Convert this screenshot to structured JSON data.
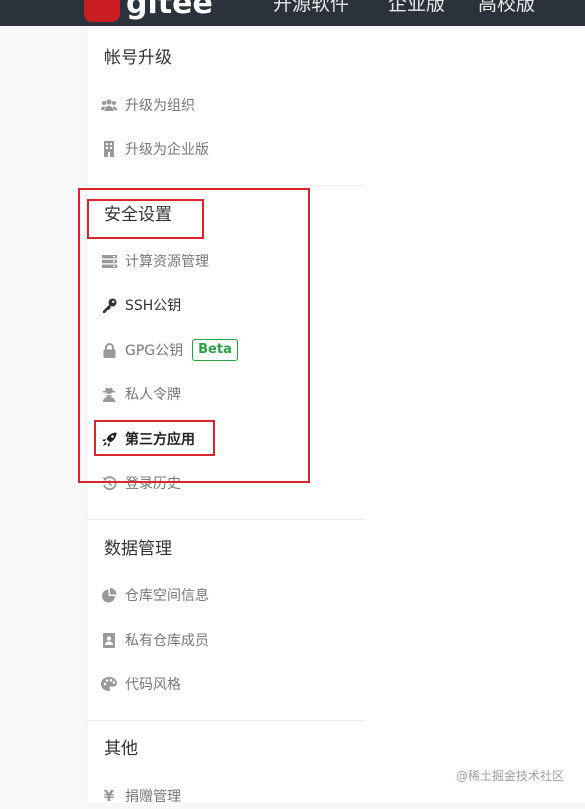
{
  "header": {
    "logo_text": "gitee",
    "nav": [
      "开源软件",
      "企业版",
      "高校版"
    ]
  },
  "sections": {
    "upgrade": {
      "title": "帐号升级",
      "items": [
        {
          "label": "升级为组织",
          "icon": "users-icon"
        },
        {
          "label": "升级为企业版",
          "icon": "building-icon"
        }
      ]
    },
    "security": {
      "title": "安全设置",
      "items": [
        {
          "label": "计算资源管理",
          "icon": "server-icon"
        },
        {
          "label": "SSH公钥",
          "icon": "key-icon"
        },
        {
          "label": "GPG公钥",
          "icon": "lock-icon",
          "badge": "Beta"
        },
        {
          "label": "私人令牌",
          "icon": "user-secret-icon"
        },
        {
          "label": "第三方应用",
          "icon": "rocket-icon"
        },
        {
          "label": "登录历史",
          "icon": "history-icon"
        }
      ]
    },
    "data": {
      "title": "数据管理",
      "items": [
        {
          "label": "仓库空间信息",
          "icon": "pie-chart-icon"
        },
        {
          "label": "私有仓库成员",
          "icon": "contact-card-icon"
        },
        {
          "label": "代码风格",
          "icon": "palette-icon"
        }
      ]
    },
    "other": {
      "title": "其他",
      "items": [
        {
          "label": "捐赠管理",
          "icon": "yen-icon"
        }
      ]
    }
  },
  "watermark": "@稀土掘金技术社区",
  "colors": {
    "header_bg": "#2c323c",
    "brand_red": "#c71d23",
    "annotation_red": "#d9262e",
    "beta_green": "#27a243"
  }
}
